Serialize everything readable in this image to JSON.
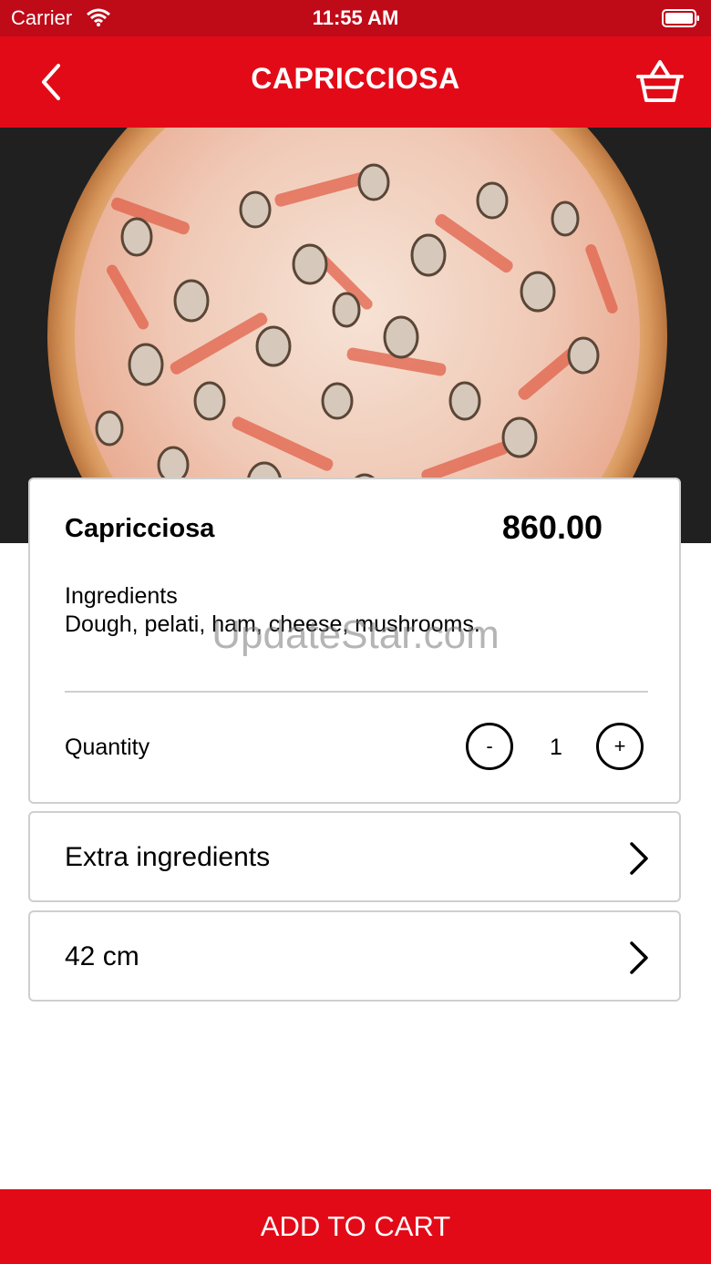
{
  "status_bar": {
    "carrier": "Carrier",
    "time": "11:55 AM"
  },
  "nav": {
    "title": "CAPRICCIOSA",
    "back_icon": "chevron-left-icon",
    "cart_icon": "basket-icon"
  },
  "hero": {
    "image_alt": "pizza-photo"
  },
  "product": {
    "name": "Capricciosa",
    "price": "860.00",
    "ingredients_label": "Ingredients",
    "ingredients_text": "Dough, pelati, ham, cheese, mushrooms."
  },
  "quantity": {
    "label": "Quantity",
    "minus_label": "-",
    "value": "1",
    "plus_label": "+"
  },
  "options": {
    "extra_label": "Extra ingredients",
    "size_label": "42 cm"
  },
  "watermark": "UpdateStar.com",
  "cta": {
    "label": "ADD TO CART"
  },
  "colors": {
    "brand_red": "#e30a17",
    "status_red": "#bf0a18"
  }
}
